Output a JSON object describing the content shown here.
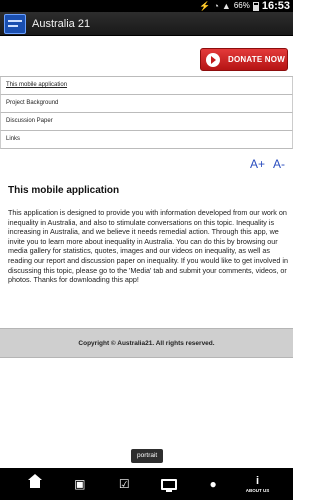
{
  "status_bar": {
    "battery_percent": "66%",
    "time": "16:53",
    "icons": [
      "usb-icon",
      "wifi-icon",
      "signal-icon",
      "battery-icon"
    ]
  },
  "action_bar": {
    "title": "Australia 21"
  },
  "donate_button": {
    "label": "DONATE NOW"
  },
  "nav": {
    "items": [
      {
        "label": "This mobile application"
      },
      {
        "label": "Project Background"
      },
      {
        "label": "Discussion Paper"
      },
      {
        "label": "Links"
      }
    ]
  },
  "font_controls": {
    "increase_label": "A+",
    "decrease_label": "A-"
  },
  "content": {
    "title": "This mobile application",
    "body": "This application is designed to provide you with information developed from our work on inequality in Australia, and also to stimulate conversations on this topic. Inequality is increasing in Australia, and we believe it needs remedial action. Through this app, we invite you to learn more about inequality in Australia. You can do this by browsing our media gallery for statistics, quotes, images and our videos on inequality, as well as reading our report and discussion paper on inequality. If you would like to get involved in discussing this topic, please go to the 'Media' tab and submit your comments, videos, or photos. Thanks for downloading this app!"
  },
  "footer": {
    "copyright": "Copyright © Australia21. All rights reserved."
  },
  "toast": {
    "text": "portrait"
  },
  "tabbar": {
    "info_label": "ABOUT US",
    "tabs": [
      "home-icon",
      "toolbox-icon",
      "document-icon",
      "tv-icon",
      "chat-icon",
      "info-icon"
    ]
  },
  "colors": {
    "donate_red": "#c21b1b",
    "link_blue": "#2a4dbf",
    "footer_gray": "#cfcfcf"
  }
}
